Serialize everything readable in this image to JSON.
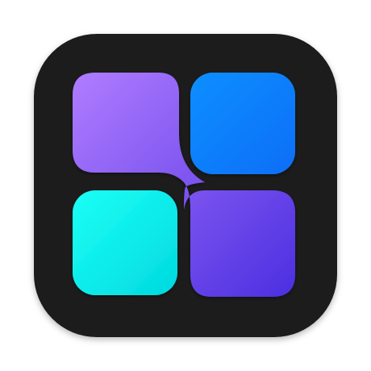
{
  "app_icon": {
    "icon": "app-grid-icon",
    "colors": {
      "background": "#1b1b1d",
      "purple_start": "#b07cff",
      "purple_end": "#4b2fe0",
      "blue_start": "#0a8fff",
      "blue_end": "#0d6ef7",
      "cyan_start": "#1cfff6",
      "cyan_end": "#00d9df"
    }
  }
}
